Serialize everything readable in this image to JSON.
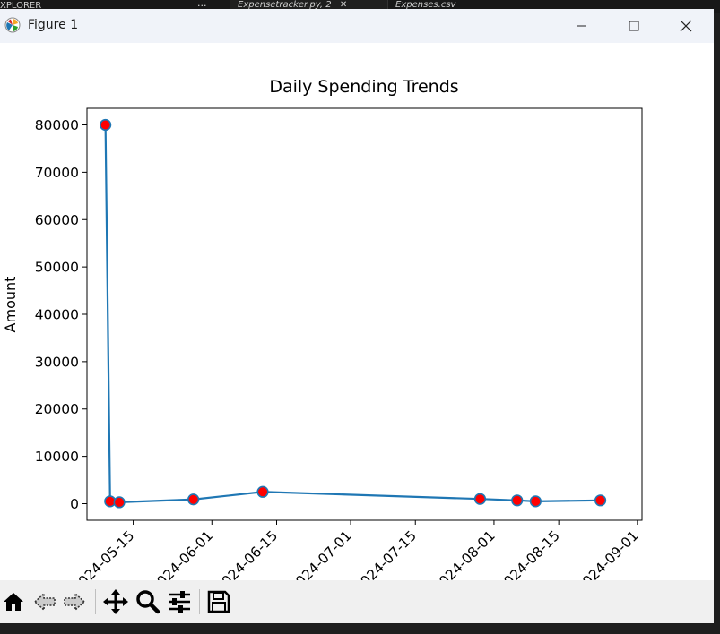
{
  "window": {
    "title": "Figure 1"
  },
  "background": {
    "explorer_label": "XPLORER",
    "explorer_more": "···",
    "tabs": [
      {
        "label": "Expensetracker.py, 2",
        "close": "✕"
      },
      {
        "label": "Expenses.csv"
      }
    ]
  },
  "toolbar": {
    "buttons": [
      {
        "name": "home-icon"
      },
      {
        "name": "back-icon"
      },
      {
        "name": "forward-icon"
      },
      {
        "name": "pan-icon"
      },
      {
        "name": "zoom-icon"
      },
      {
        "name": "configure-subplots-icon"
      },
      {
        "name": "save-icon"
      }
    ]
  },
  "chart_data": {
    "type": "line",
    "title": "Daily Spending Trends",
    "xlabel": "",
    "ylabel": "Amount",
    "x": [
      "2024-05-09",
      "2024-05-10",
      "2024-05-12",
      "2024-05-28",
      "2024-06-12",
      "2024-07-29",
      "2024-08-06",
      "2024-08-10",
      "2024-08-24"
    ],
    "y": [
      80000,
      500,
      300,
      900,
      2500,
      1000,
      700,
      500,
      700
    ],
    "xlim": [
      "2024-05-05",
      "2024-09-02"
    ],
    "ylim": [
      -3500,
      83500
    ],
    "xticks": [
      "2024-05-15",
      "2024-06-01",
      "2024-06-15",
      "2024-07-01",
      "2024-07-15",
      "2024-08-01",
      "2024-08-15",
      "2024-09-01"
    ],
    "yticks": [
      0,
      10000,
      20000,
      30000,
      40000,
      50000,
      60000,
      70000,
      80000
    ],
    "line_color": "#1f77b4",
    "marker_color": "#ff0000",
    "marker_edge_color": "#1f77b4",
    "grid": false
  }
}
